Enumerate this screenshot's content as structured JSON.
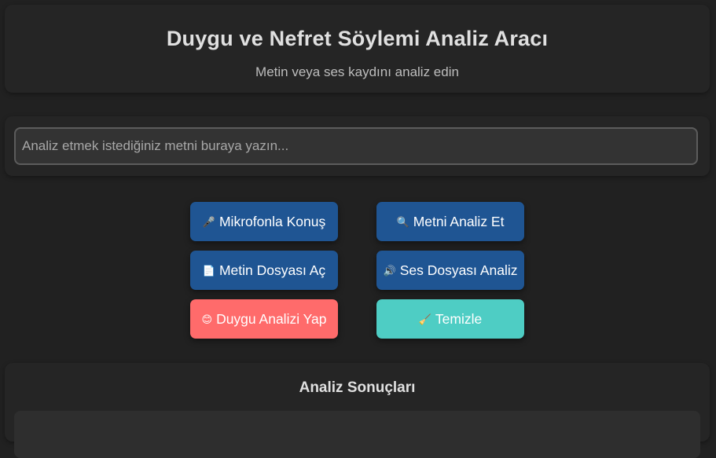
{
  "header": {
    "title": "Duygu ve Nefret Söylemi Analiz Aracı",
    "subtitle": "Metin veya ses kaydını analiz edin"
  },
  "input": {
    "placeholder": "Analiz etmek istediğiniz metni buraya yazın...",
    "value": ""
  },
  "buttons": {
    "microphone": {
      "label": "Mikrofonla Konuş",
      "icon": "🎤",
      "icon_name": "microphone-icon"
    },
    "analyze_text": {
      "label": "Metni Analiz Et",
      "icon": "🔍",
      "icon_name": "magnifier-icon"
    },
    "open_text_file": {
      "label": "Metin Dosyası Aç",
      "icon": "📄",
      "icon_name": "document-icon"
    },
    "audio_file": {
      "label": "Ses Dosyası Analiz",
      "icon": "🔊",
      "icon_name": "speaker-icon"
    },
    "sentiment": {
      "label": "Duygu Analizi Yap",
      "icon": "😊",
      "icon_name": "smiley-icon"
    },
    "clear": {
      "label": "Temizle",
      "icon": "🧹",
      "icon_name": "broom-icon"
    }
  },
  "results": {
    "title": "Analiz Sonuçları"
  },
  "colors": {
    "background": "#212121",
    "card": "#252525",
    "primary_button": "#1f5593",
    "sentiment_button": "#ff6b6b",
    "clear_button": "#4ecdc4"
  }
}
